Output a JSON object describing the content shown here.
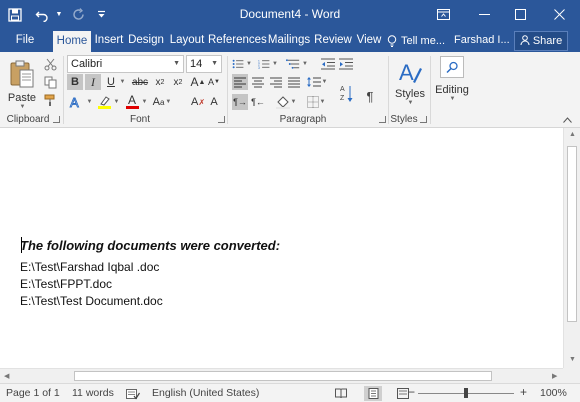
{
  "titlebar": {
    "title": "Document4 - Word",
    "save_icon": "save-icon",
    "undo_icon": "undo-icon",
    "redo_icon": "redo-icon",
    "customize_icon": "customize-quick-access-icon"
  },
  "tabs": [
    "File",
    "Home",
    "Insert",
    "Design",
    "Layout",
    "References",
    "Mailings",
    "Review",
    "View"
  ],
  "active_tab": "Home",
  "tell_me": "Tell me...",
  "user_name": "Farshad I...",
  "share_label": "Share",
  "ribbon": {
    "clipboard": {
      "paste_label": "Paste",
      "group_label": "Clipboard"
    },
    "font": {
      "font_name": "Calibri",
      "font_size": "14",
      "group_label": "Font"
    },
    "paragraph": {
      "group_label": "Paragraph"
    },
    "styles": {
      "styles_label": "Styles",
      "group_label": "Styles"
    },
    "editing": {
      "editing_label": "Editing"
    }
  },
  "document": {
    "heading": "The following documents were converted:",
    "lines": [
      "E:\\Test\\Farshad Iqbal .doc",
      "E:\\Test\\FPPT.doc",
      "E:\\Test\\Test Document.doc"
    ]
  },
  "status": {
    "page": "Page 1 of 1",
    "words": "11 words",
    "language": "English (United States)",
    "zoom": "100%"
  },
  "colors": {
    "accent": "#2b579a",
    "ribbon_bg": "#f3f3f3",
    "highlight": "#ffff00",
    "font_color": "#e00000"
  }
}
